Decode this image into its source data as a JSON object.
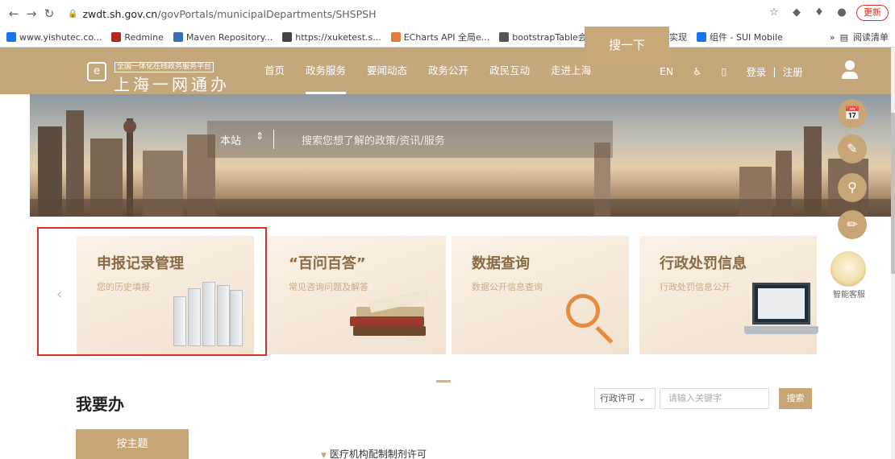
{
  "browser": {
    "url_host": "zwdt.sh.gov.cn",
    "url_path": "/govPortals/municipalDepartments/SHSPSH",
    "update_label": "更新",
    "bookmarks": [
      {
        "label": "www.yishutec.co...",
        "color": "#1a73e8"
      },
      {
        "label": "Redmine",
        "color": "#b0281c"
      },
      {
        "label": "Maven Repository...",
        "color": "#3a6fb6"
      },
      {
        "label": "https://xuketest.s...",
        "color": "#444444"
      },
      {
        "label": "ECharts API 全局e...",
        "color": "#e07b39"
      },
      {
        "label": "bootstrapTable会...",
        "color": "#555555"
      },
      {
        "label": "token的生成实现",
        "color": "#555555"
      },
      {
        "label": "组件 - SUI Mobile",
        "color": "#1a73e8"
      }
    ],
    "more_label": "»",
    "reading_list_label": "阅读清单"
  },
  "header": {
    "logo_small": "全国一体化在线政务服务平台",
    "logo_main": "上海一网通办",
    "nav": [
      "首页",
      "政务服务",
      "要闻动态",
      "政务公开",
      "政民互动",
      "走进上海"
    ],
    "active_nav": 1,
    "lang": "EN",
    "login": "登录",
    "sep": "|",
    "register": "注册"
  },
  "search": {
    "scope": "本站",
    "placeholder": "搜索您想了解的政策/资讯/服务",
    "button": "搜一下"
  },
  "float_bar": {
    "bot_label": "智能客服"
  },
  "cards": [
    {
      "title": "申报记录管理",
      "subtitle": "您的历史填报"
    },
    {
      "title": "“百问百答”",
      "subtitle": "常见咨询问题及解答"
    },
    {
      "title": "数据查询",
      "subtitle": "数据公开信息查询"
    },
    {
      "title": "行政处罚信息",
      "subtitle": "行政处罚信息公开"
    }
  ],
  "todo": {
    "title": "我要办",
    "filter_value": "行政许可",
    "keyword_placeholder": "请输入关键字",
    "search_button": "搜索",
    "theme_tab": "按主题",
    "first_item": "医疗机构配制制剂许可"
  },
  "colors": {
    "brand": "#c5a77c",
    "highlight": "#d93025"
  }
}
